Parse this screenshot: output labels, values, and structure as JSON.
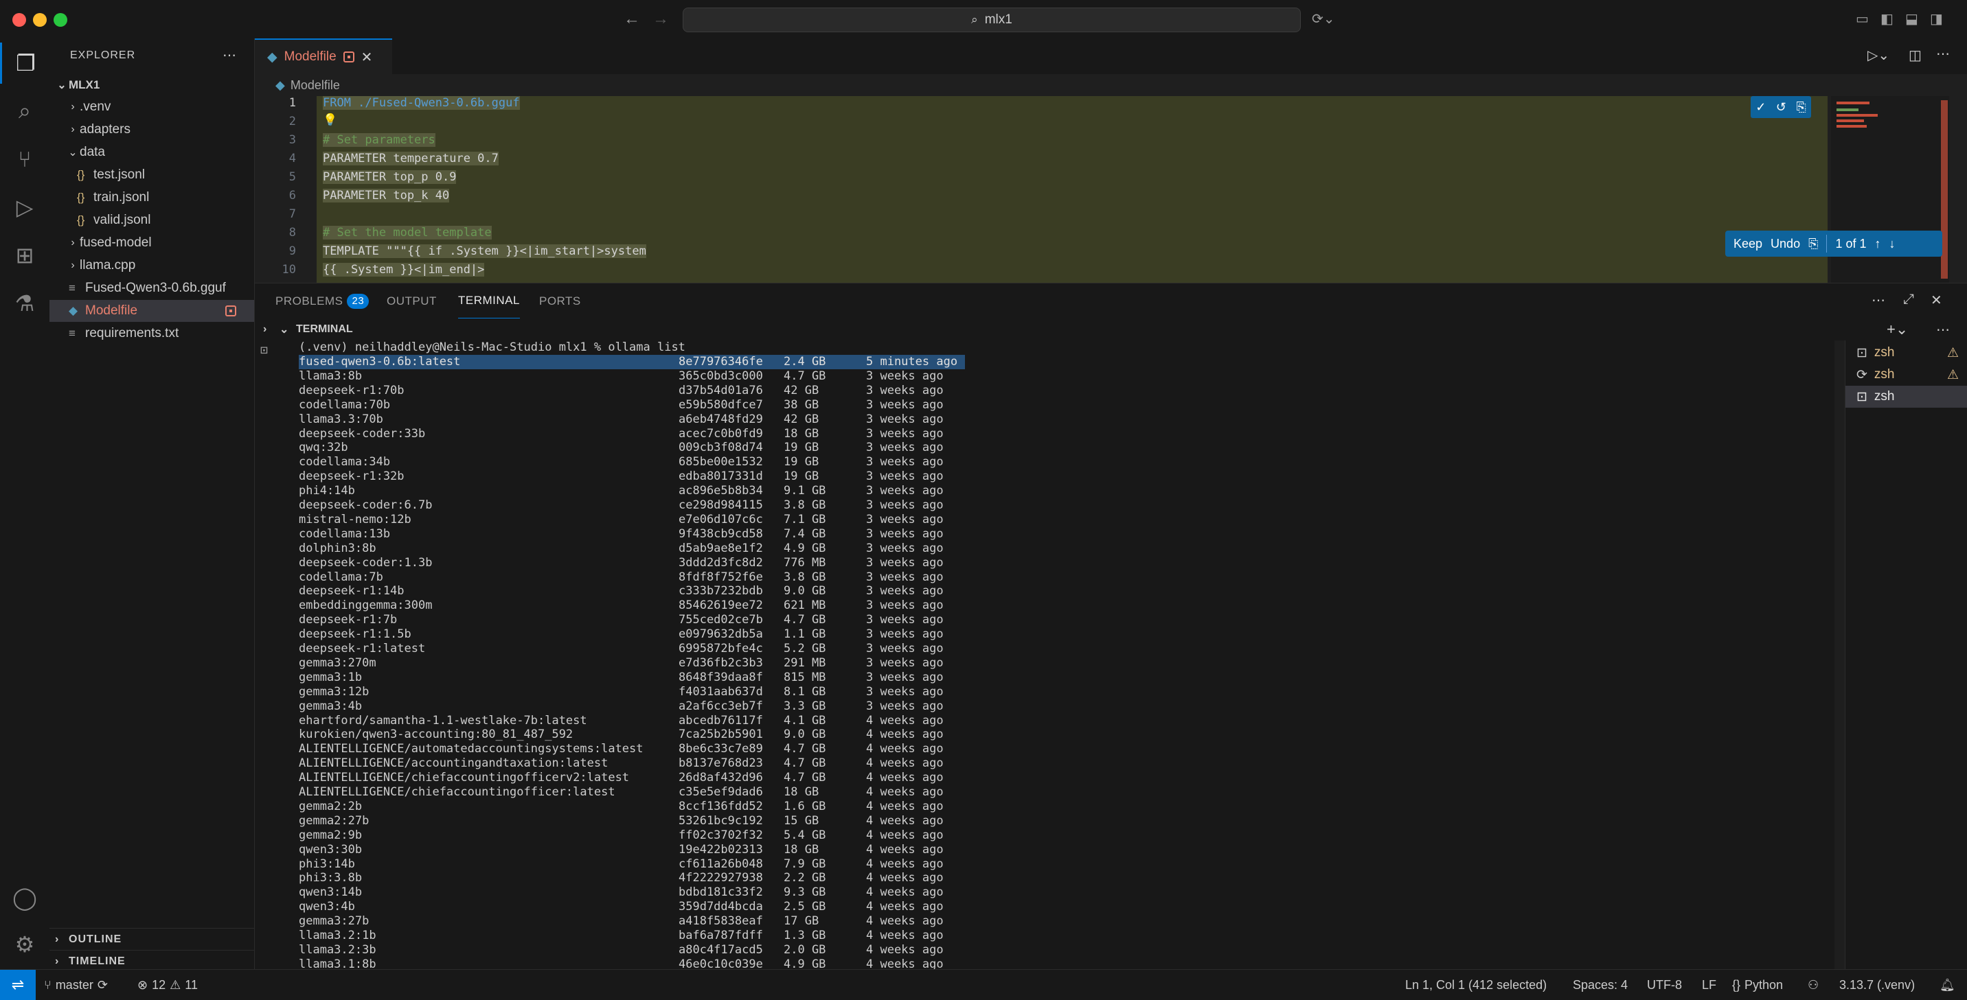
{
  "window": {
    "command_center": "mlx1",
    "colors": {
      "accent": "#0078d4",
      "modified": "#e9806e",
      "folder_chevron": "#cccccc"
    }
  },
  "activity_bar": {
    "items": [
      "explorer-icon",
      "search-icon",
      "source-control-icon",
      "run-debug-icon",
      "extensions-icon",
      "testing-icon"
    ],
    "bottom": [
      "account-icon",
      "gear-icon"
    ]
  },
  "sidebar": {
    "title": "EXPLORER",
    "root": "MLX1",
    "items": [
      {
        "label": ".venv",
        "kind": "folder"
      },
      {
        "label": "adapters",
        "kind": "folder"
      },
      {
        "label": "data",
        "kind": "folder-open"
      },
      {
        "label": "test.jsonl",
        "kind": "json"
      },
      {
        "label": "train.jsonl",
        "kind": "json"
      },
      {
        "label": "valid.jsonl",
        "kind": "json"
      },
      {
        "label": "fused-model",
        "kind": "folder"
      },
      {
        "label": "llama.cpp",
        "kind": "folder"
      },
      {
        "label": "Fused-Qwen3-0.6b.gguf",
        "kind": "file"
      },
      {
        "label": "Modelfile",
        "kind": "modelfile"
      },
      {
        "label": "requirements.txt",
        "kind": "file"
      }
    ],
    "outline": "OUTLINE",
    "timeline": "TIMELINE"
  },
  "editor": {
    "tab_label": "Modelfile",
    "breadcrumb": "Modelfile",
    "lines": [
      {
        "n": "1",
        "text": "FROM ./Fused-Qwen3-0.6b.gguf"
      },
      {
        "n": "2",
        "text": "💡"
      },
      {
        "n": "3",
        "text": "# Set parameters"
      },
      {
        "n": "4",
        "text": "PARAMETER temperature 0.7"
      },
      {
        "n": "5",
        "text": "PARAMETER top_p 0.9"
      },
      {
        "n": "6",
        "text": "PARAMETER top_k 40"
      },
      {
        "n": "7",
        "text": ""
      },
      {
        "n": "8",
        "text": "# Set the model template"
      },
      {
        "n": "9",
        "text": "TEMPLATE \"\"\"{{ if .System }}<|im_start|>system"
      },
      {
        "n": "10",
        "text": "{{ .System }}<|im_end|>"
      }
    ],
    "keep_bar": {
      "keep": "Keep",
      "undo": "Undo",
      "count": "1 of 1"
    }
  },
  "panel": {
    "tabs": [
      {
        "label": "PROBLEMS",
        "badge": "23"
      },
      {
        "label": "OUTPUT"
      },
      {
        "label": "TERMINAL"
      },
      {
        "label": "PORTS"
      }
    ],
    "terminal_header": "TERMINAL",
    "prompt": "(.venv) neilhaddley@Neils-Mac-Studio mlx1 % ollama list",
    "rows": [
      [
        "fused-qwen3-0.6b:latest",
        "8e77976346fe",
        "2.4 GB",
        "5 minutes ago"
      ],
      [
        "llama3:8b",
        "365c0bd3c000",
        "4.7 GB",
        "3 weeks ago"
      ],
      [
        "deepseek-r1:70b",
        "d37b54d01a76",
        "42 GB",
        "3 weeks ago"
      ],
      [
        "codellama:70b",
        "e59b580dfce7",
        "38 GB",
        "3 weeks ago"
      ],
      [
        "llama3.3:70b",
        "a6eb4748fd29",
        "42 GB",
        "3 weeks ago"
      ],
      [
        "deepseek-coder:33b",
        "acec7c0b0fd9",
        "18 GB",
        "3 weeks ago"
      ],
      [
        "qwq:32b",
        "009cb3f08d74",
        "19 GB",
        "3 weeks ago"
      ],
      [
        "codellama:34b",
        "685be00e1532",
        "19 GB",
        "3 weeks ago"
      ],
      [
        "deepseek-r1:32b",
        "edba8017331d",
        "19 GB",
        "3 weeks ago"
      ],
      [
        "phi4:14b",
        "ac896e5b8b34",
        "9.1 GB",
        "3 weeks ago"
      ],
      [
        "deepseek-coder:6.7b",
        "ce298d984115",
        "3.8 GB",
        "3 weeks ago"
      ],
      [
        "mistral-nemo:12b",
        "e7e06d107c6c",
        "7.1 GB",
        "3 weeks ago"
      ],
      [
        "codellama:13b",
        "9f438cb9cd58",
        "7.4 GB",
        "3 weeks ago"
      ],
      [
        "dolphin3:8b",
        "d5ab9ae8e1f2",
        "4.9 GB",
        "3 weeks ago"
      ],
      [
        "deepseek-coder:1.3b",
        "3ddd2d3fc8d2",
        "776 MB",
        "3 weeks ago"
      ],
      [
        "codellama:7b",
        "8fdf8f752f6e",
        "3.8 GB",
        "3 weeks ago"
      ],
      [
        "deepseek-r1:14b",
        "c333b7232bdb",
        "9.0 GB",
        "3 weeks ago"
      ],
      [
        "embeddinggemma:300m",
        "85462619ee72",
        "621 MB",
        "3 weeks ago"
      ],
      [
        "deepseek-r1:7b",
        "755ced02ce7b",
        "4.7 GB",
        "3 weeks ago"
      ],
      [
        "deepseek-r1:1.5b",
        "e0979632db5a",
        "1.1 GB",
        "3 weeks ago"
      ],
      [
        "deepseek-r1:latest",
        "6995872bfe4c",
        "5.2 GB",
        "3 weeks ago"
      ],
      [
        "gemma3:270m",
        "e7d36fb2c3b3",
        "291 MB",
        "3 weeks ago"
      ],
      [
        "gemma3:1b",
        "8648f39daa8f",
        "815 MB",
        "3 weeks ago"
      ],
      [
        "gemma3:12b",
        "f4031aab637d",
        "8.1 GB",
        "3 weeks ago"
      ],
      [
        "gemma3:4b",
        "a2af6cc3eb7f",
        "3.3 GB",
        "3 weeks ago"
      ],
      [
        "ehartford/samantha-1.1-westlake-7b:latest",
        "abcedb76117f",
        "4.1 GB",
        "4 weeks ago"
      ],
      [
        "kurokien/qwen3-accounting:80_81_487_592",
        "7ca25b2b5901",
        "9.0 GB",
        "4 weeks ago"
      ],
      [
        "ALIENTELLIGENCE/automatedaccountingsystems:latest",
        "8be6c33c7e89",
        "4.7 GB",
        "4 weeks ago"
      ],
      [
        "ALIENTELLIGENCE/accountingandtaxation:latest",
        "b8137e768d23",
        "4.7 GB",
        "4 weeks ago"
      ],
      [
        "ALIENTELLIGENCE/chiefaccountingofficerv2:latest",
        "26d8af432d96",
        "4.7 GB",
        "4 weeks ago"
      ],
      [
        "ALIENTELLIGENCE/chiefaccountingofficer:latest",
        "c35e5ef9dad6",
        "18 GB",
        "4 weeks ago"
      ],
      [
        "gemma2:2b",
        "8ccf136fdd52",
        "1.6 GB",
        "4 weeks ago"
      ],
      [
        "gemma2:27b",
        "53261bc9c192",
        "15 GB",
        "4 weeks ago"
      ],
      [
        "gemma2:9b",
        "ff02c3702f32",
        "5.4 GB",
        "4 weeks ago"
      ],
      [
        "qwen3:30b",
        "19e422b02313",
        "18 GB",
        "4 weeks ago"
      ],
      [
        "phi3:14b",
        "cf611a26b048",
        "7.9 GB",
        "4 weeks ago"
      ],
      [
        "phi3:3.8b",
        "4f2222927938",
        "2.2 GB",
        "4 weeks ago"
      ],
      [
        "qwen3:14b",
        "bdbd181c33f2",
        "9.3 GB",
        "4 weeks ago"
      ],
      [
        "qwen3:4b",
        "359d7dd4bcda",
        "2.5 GB",
        "4 weeks ago"
      ],
      [
        "gemma3:27b",
        "a418f5838eaf",
        "17 GB",
        "4 weeks ago"
      ],
      [
        "llama3.2:1b",
        "baf6a787fdff",
        "1.3 GB",
        "4 weeks ago"
      ],
      [
        "llama3.2:3b",
        "a80c4f17acd5",
        "2.0 GB",
        "4 weeks ago"
      ],
      [
        "llama3.1:8b",
        "46e0c10c039e",
        "4.9 GB",
        "4 weeks ago"
      ]
    ],
    "terminals": [
      {
        "label": "zsh",
        "warn": true
      },
      {
        "label": "zsh",
        "warn": true
      },
      {
        "label": "zsh",
        "warn": false
      }
    ]
  },
  "status_bar": {
    "branch": "master",
    "errors": "12",
    "warnings": "11",
    "cursor": "Ln 1, Col 1 (412 selected)",
    "spaces": "Spaces: 4",
    "encoding": "UTF-8",
    "eol": "LF",
    "language": "Python",
    "python": "3.13.7 (.venv)"
  }
}
